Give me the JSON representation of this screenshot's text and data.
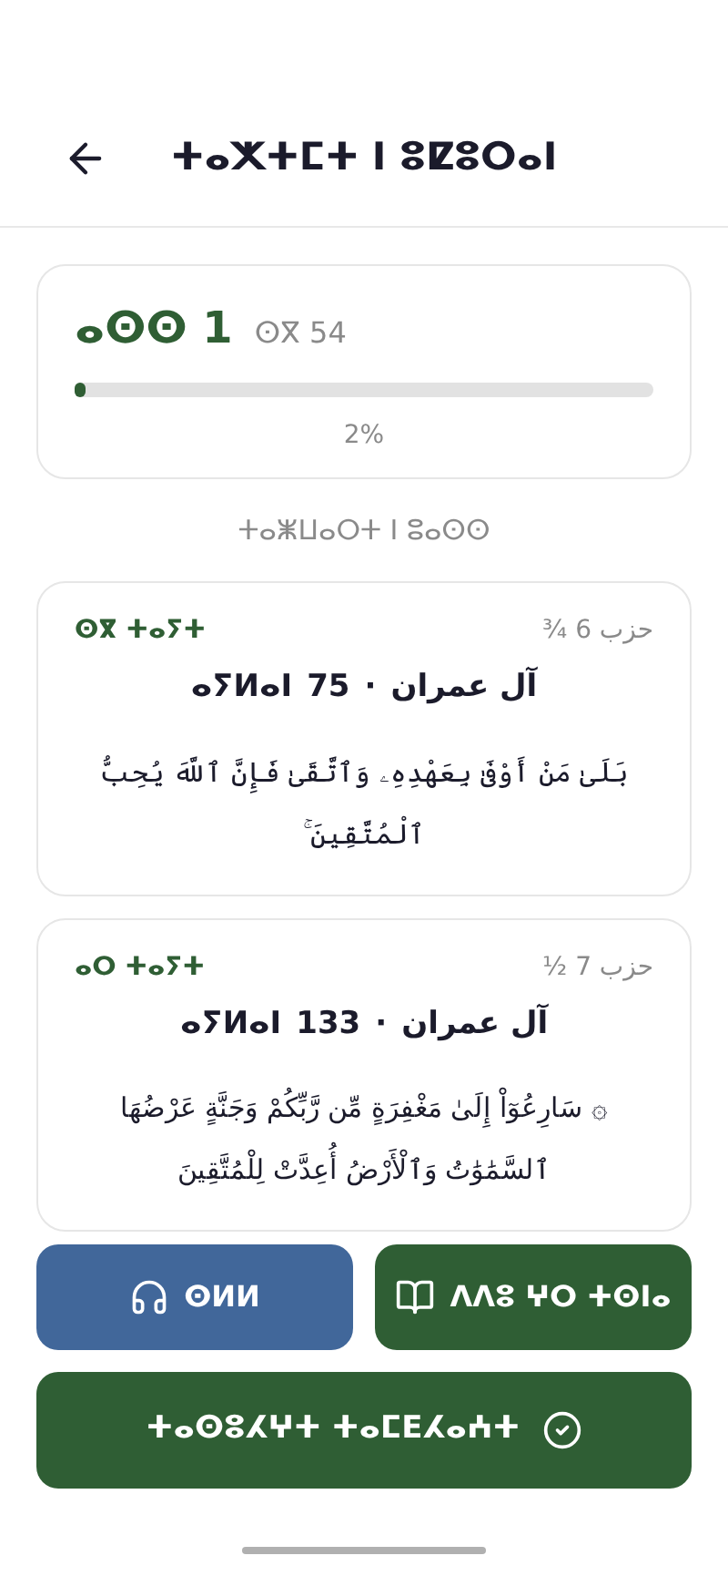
{
  "header": {
    "title": "ⵜⴰⵅⵜⵎⵜ ⵏ ⵓⵇⵓⵔⴰⵏ"
  },
  "progress": {
    "day": "ⴰⵙⵙ 1",
    "total": "ⵙⴳ 54",
    "level": 0.02,
    "percent": "2%"
  },
  "section_title": "ⵜⴰⵥⵡⴰⵔⵜ ⵏ ⵓⴰⵙⵙ",
  "cards": [
    {
      "label": "ⵙⴳ ⵜⴰⵢⵜ",
      "hizb": "حزب 6 ¾",
      "surah": "آل عمران",
      "ayah": "75",
      "ayah_word": "ⴰⵢⵍⴰⵏ",
      "separator": "·",
      "verse": "بَلَىٰ مَنْ أَوْفَىٰ بِعَهْدِهِۦ وَٱتَّقَىٰ فَإِنَّ ٱللَّهَ يُحِبُّ ٱلْمُتَّقِينَ ۚ"
    },
    {
      "label": "ⴰⵔ ⵜⴰⵢⵜ",
      "hizb": "حزب 7 ½",
      "surah": "آل عمران",
      "ayah": "133",
      "ayah_word": "ⴰⵢⵍⴰⵏ",
      "separator": "·",
      "verse": "۞ سَارِعُوٓاْ إِلَىٰ مَغْفِرَةٍ مِّن رَّبِّكُمْ وَجَنَّةٍ عَرْضُهَا ٱلسَّمَٰوَٰتُ وَٱلْأَرْضُ أُعِدَّتْ لِلْمُتَّقِينَ"
    }
  ],
  "buttons": {
    "listen": "ⵙⵍⵍ",
    "go_to_page": "ⴷⴷⵓ ⵖⵔ ⵜⵙⵏⴰ",
    "complete": "ⵜⴰⵙⵓⵃⵖⵜ ⵜⴰⵎⴹⵃⴰⵄⵜ"
  }
}
